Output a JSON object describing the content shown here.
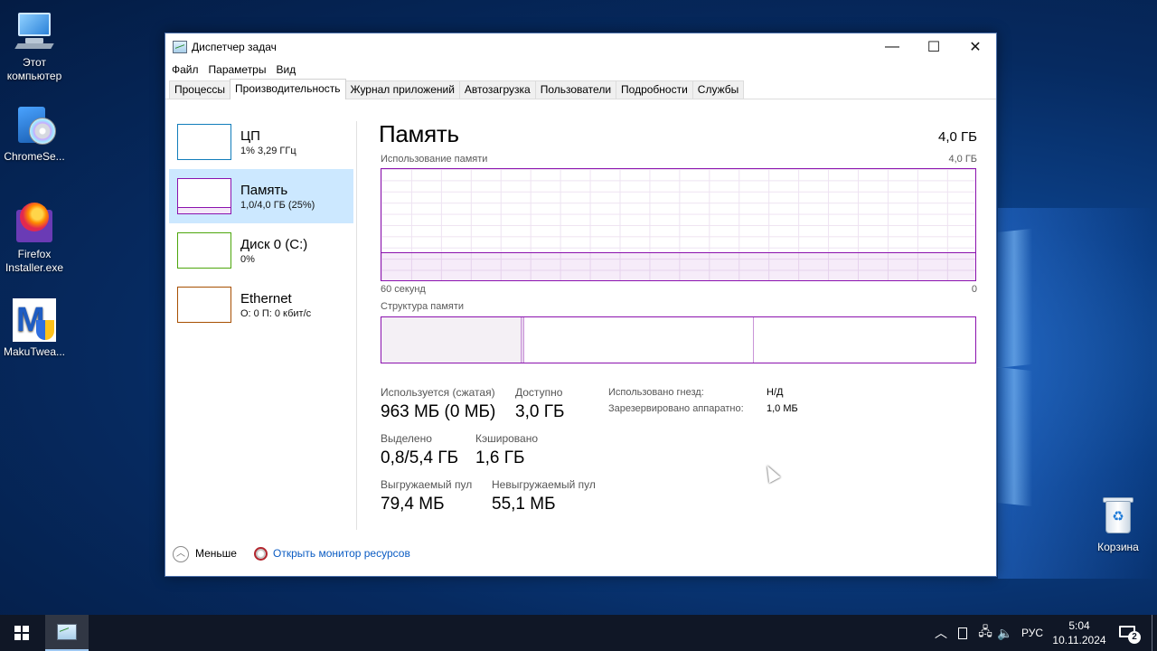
{
  "desktop": {
    "icons": [
      {
        "label": "Этот компьютер"
      },
      {
        "label": "ChromeSe..."
      },
      {
        "label": "Firefox Installer.exe"
      },
      {
        "label": "MakuTwea..."
      },
      {
        "label": "Корзина"
      }
    ]
  },
  "window": {
    "title": "Диспетчер задач",
    "controls": {
      "minimize": "—",
      "maximize": "☐",
      "close": "✕"
    },
    "menu": [
      "Файл",
      "Параметры",
      "Вид"
    ],
    "tabs": [
      "Процессы",
      "Производительность",
      "Журнал приложений",
      "Автозагрузка",
      "Пользователи",
      "Подробности",
      "Службы"
    ],
    "active_tab": "Производительность"
  },
  "resources": [
    {
      "name": "ЦП",
      "sub": "1% 3,29 ГГц",
      "color": "#117dbb"
    },
    {
      "name": "Память",
      "sub": "1,0/4,0 ГБ (25%)",
      "color": "#8b12ae"
    },
    {
      "name": "Диск 0 (C:)",
      "sub": "0%",
      "color": "#4da60c"
    },
    {
      "name": "Ethernet",
      "sub": "О: 0 П: 0 кбит/с",
      "color": "#a74f01"
    }
  ],
  "memory": {
    "title": "Память",
    "total": "4,0 ГБ",
    "usage_label": "Использование памяти",
    "usage_max": "4,0 ГБ",
    "usage_fraction": 0.25,
    "time_left": "60 секунд",
    "time_right": "0",
    "structure_label": "Структура памяти",
    "stats": {
      "in_use_label": "Используется (сжатая)",
      "in_use_value": "963 МБ (0 МБ)",
      "available_label": "Доступно",
      "available_value": "3,0 ГБ",
      "committed_label": "Выделено",
      "committed_value": "0,8/5,4 ГБ",
      "cached_label": "Кэшировано",
      "cached_value": "1,6 ГБ",
      "paged_label": "Выгружаемый пул",
      "paged_value": "79,4 МБ",
      "nonpaged_label": "Невыгружаемый пул",
      "nonpaged_value": "55,1 МБ",
      "slots_label": "Использовано гнезд:",
      "slots_value": "Н/Д",
      "reserved_label": "Зарезервировано аппаратно:",
      "reserved_value": "1,0 МБ"
    }
  },
  "footer": {
    "less_label": "Меньше",
    "monitor_link": "Открыть монитор ресурсов"
  },
  "taskbar": {
    "language": "РУС",
    "time": "5:04",
    "date": "10.11.2024",
    "notifications": "2"
  }
}
